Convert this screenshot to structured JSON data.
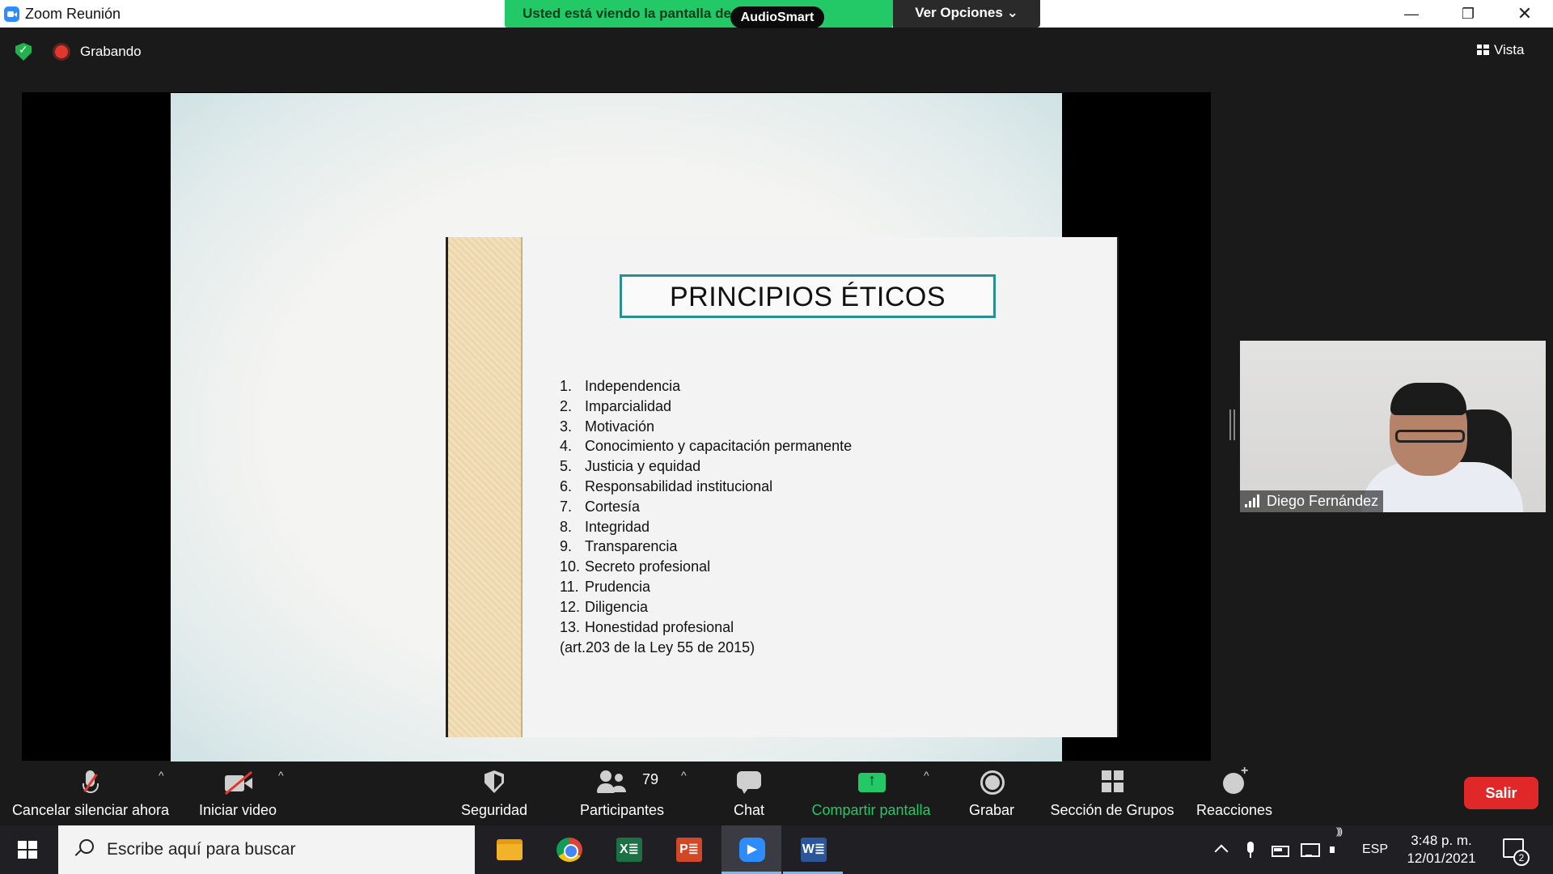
{
  "window": {
    "title": "Zoom Reunión",
    "share_banner": "Usted está viendo la pantalla de Tecnología",
    "view_options": "Ver Opciones ⌄",
    "overlay_badge": "AudioSmart",
    "minimize": "—",
    "restore": "❐",
    "close": "✕"
  },
  "meeting": {
    "recording_label": "Grabando",
    "view_label": "Vista"
  },
  "slide": {
    "title": "PRINCIPIOS ÉTICOS",
    "items": [
      {
        "num": "1.",
        "text": "Independencia"
      },
      {
        "num": "2.",
        "text": "Imparcialidad"
      },
      {
        "num": "3.",
        "text": "Motivación"
      },
      {
        "num": "4.",
        "text": "Conocimiento y capacitación permanente"
      },
      {
        "num": "5.",
        "text": "Justicia y equidad"
      },
      {
        "num": "6.",
        "text": "Responsabilidad institucional"
      },
      {
        "num": "7.",
        "text": "Cortesía"
      },
      {
        "num": "8.",
        "text": "Integridad"
      },
      {
        "num": "9.",
        "text": "Transparencia"
      },
      {
        "num": "10.",
        "text": "Secreto profesional"
      },
      {
        "num": "11.",
        "text": "Prudencia"
      },
      {
        "num": "12.",
        "text": "Diligencia"
      },
      {
        "num": "13.",
        "text": "Honestidad profesional"
      }
    ],
    "reference": "(art.203 de la Ley 55 de 2015)"
  },
  "participant": {
    "name": "Diego Fernández"
  },
  "toolbar": {
    "mute_label": "Cancelar silenciar ahora",
    "video_label": "Iniciar video",
    "security_label": "Seguridad",
    "participants_label": "Participantes",
    "participants_count": "79",
    "chat_label": "Chat",
    "share_label": "Compartir pantalla",
    "record_label": "Grabar",
    "breakout_label": "Sección de Grupos",
    "reactions_label": "Reacciones",
    "leave_label": "Salir",
    "caret": "^",
    "share_color": "#23c966",
    "leave_color": "#e02828"
  },
  "taskbar": {
    "search_placeholder": "Escribe aquí para buscar",
    "apps": [
      "file-explorer",
      "chrome",
      "excel",
      "powerpoint",
      "zoom",
      "word"
    ],
    "excel_glyph": "X≣",
    "ppt_glyph": "P≣",
    "zoom_glyph": "▶",
    "word_glyph": "W≣",
    "language": "ESP",
    "time": "3:48 p. m.",
    "date": "12/01/2021",
    "notification_count": "2"
  }
}
